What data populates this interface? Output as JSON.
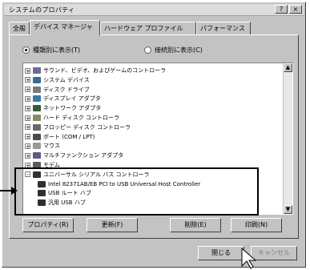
{
  "window": {
    "title": "システムのプロパティ",
    "help_label": "?",
    "close_label": "×"
  },
  "tabs": [
    {
      "label": "全般",
      "active": false
    },
    {
      "label": "デバイス マネージャ",
      "active": true
    },
    {
      "label": "ハードウェア プロファイル",
      "active": false
    },
    {
      "label": "パフォーマンス",
      "active": false
    }
  ],
  "view_options": [
    {
      "label": "種類別に表示(T)",
      "selected": true
    },
    {
      "label": "接続別に表示(C)",
      "selected": false
    }
  ],
  "tree": {
    "items": [
      {
        "label": "サウンド、ビデオ、およびゲームのコントローラ",
        "icon": "sound-icon",
        "color": "#6a6a9a",
        "expander": "+",
        "indent": 0
      },
      {
        "label": "システム デバイス",
        "icon": "system-device-icon",
        "color": "#3a6a9a",
        "expander": "+",
        "indent": 0
      },
      {
        "label": "ディスク ドライブ",
        "icon": "disk-drive-icon",
        "color": "#7a7a7a",
        "expander": "+",
        "indent": 0
      },
      {
        "label": "ディスプレイ アダプタ",
        "icon": "display-icon",
        "color": "#3a7aa0",
        "expander": "+",
        "indent": 0
      },
      {
        "label": "ネットワーク アダプタ",
        "icon": "network-icon",
        "color": "#3a5a3a",
        "expander": "+",
        "indent": 0
      },
      {
        "label": "ハード ディスク コントローラ",
        "icon": "hdd-controller-icon",
        "color": "#8a8a6a",
        "expander": "+",
        "indent": 0
      },
      {
        "label": "フロッピー ディスク コントローラ",
        "icon": "floppy-controller-icon",
        "color": "#6a6a6a",
        "expander": "+",
        "indent": 0
      },
      {
        "label": "ポート (COM / LPT)",
        "icon": "port-icon",
        "color": "#4a4a4a",
        "expander": "+",
        "indent": 0
      },
      {
        "label": "マウス",
        "icon": "mouse-icon",
        "color": "#9a9a9a",
        "expander": "+",
        "indent": 0
      },
      {
        "label": "マルチファンクション アダプタ",
        "icon": "multifunction-icon",
        "color": "#5a5a8a",
        "expander": "+",
        "indent": 0
      },
      {
        "label": "モデム",
        "icon": "modem-icon",
        "color": "#5a5a5a",
        "expander": "+",
        "indent": 0
      },
      {
        "label": "ユニバーサル シリアル バス コントローラ",
        "icon": "usb-icon",
        "color": "#303030",
        "expander": "-",
        "indent": 0
      },
      {
        "label": "Intel 82371AB/EB PCI to USB Universal Host Controller",
        "icon": "usb-icon",
        "color": "#303030",
        "expander": "",
        "indent": 1
      },
      {
        "label": "USB ルート ハブ",
        "icon": "usb-icon",
        "color": "#303030",
        "expander": "",
        "indent": 1
      },
      {
        "label": "汎用 USB ハブ",
        "icon": "usb-icon",
        "color": "#303030",
        "expander": "",
        "indent": 1
      }
    ]
  },
  "panel_buttons": {
    "properties": "プロパティ(R)",
    "refresh": "更新(F)",
    "remove": "削除(E)",
    "print": "印刷(N)"
  },
  "footer_buttons": {
    "ok": "閉じる",
    "cancel": "キャンセル"
  }
}
